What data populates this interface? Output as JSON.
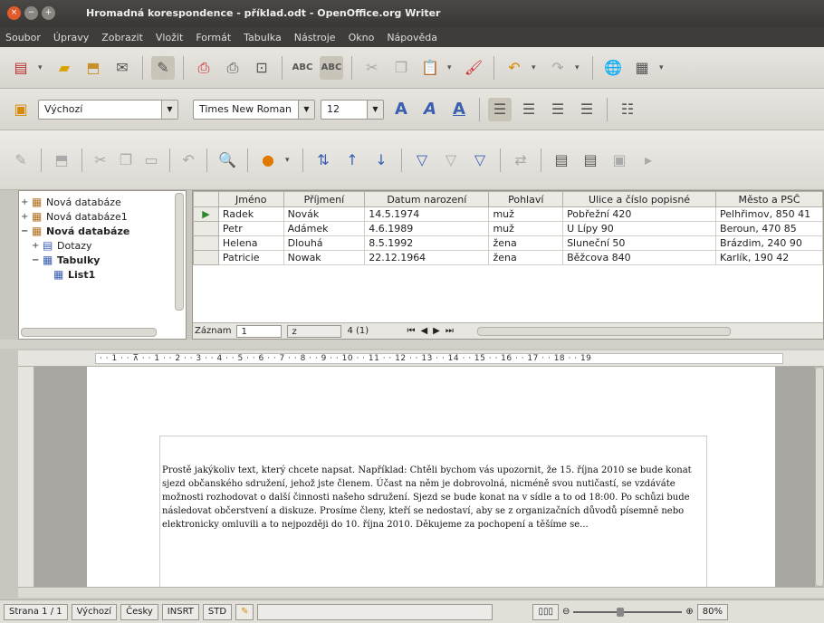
{
  "window": {
    "title": "Hromadná korespondence - příklad.odt - OpenOffice.org Writer"
  },
  "menu": [
    "Soubor",
    "Úpravy",
    "Zobrazit",
    "Vložit",
    "Formát",
    "Tabulka",
    "Nástroje",
    "Okno",
    "Nápověda"
  ],
  "toolbar": {
    "style_value": "Výchozí",
    "font_value": "Times New Roman",
    "size_value": "12"
  },
  "tree": {
    "items": [
      {
        "label": "Nová databáze",
        "expander": "+",
        "bold": false
      },
      {
        "label": "Nová databáze1",
        "expander": "+",
        "bold": false
      },
      {
        "label": "Nová databáze",
        "expander": "−",
        "bold": true
      },
      {
        "label": "Dotazy",
        "expander": "+",
        "bold": false
      },
      {
        "label": "Tabulky",
        "expander": "−",
        "bold": true
      },
      {
        "label": "List1",
        "expander": "",
        "bold": true
      }
    ]
  },
  "grid": {
    "columns": [
      "Jméno",
      "Příjmení",
      "Datum narození",
      "Pohlaví",
      "Ulice a číslo popisné",
      "Město a PSČ"
    ],
    "rows": [
      [
        "Radek",
        "Novák",
        "14.5.1974",
        "muž",
        "Pobřežní 420",
        "Pelhřimov, 850 41"
      ],
      [
        "Petr",
        "Adámek",
        "4.6.1989",
        "muž",
        "U Lípy 90",
        "Beroun, 470 85"
      ],
      [
        "Helena",
        "Dlouhá",
        "8.5.1992",
        "žena",
        "Sluneční 50",
        "Brázdim, 240 90"
      ],
      [
        "Patricie",
        "Nowak",
        "22.12.1964",
        "žena",
        "Běžcova 840",
        "Karlík, 190 42"
      ]
    ],
    "nav": {
      "record_label": "Záznam",
      "record_value": "1",
      "of_label": "z",
      "count": "4 (1)"
    }
  },
  "ruler": {
    "marks": "· · 1 · · ⊼ · · 1 · · 2 · · 3 · · 4 · · 5 · · 6 · · 7 · · 8 · · 9 · · 10 · · 11 · · 12 · · 13 · · 14 · · 15 · · 16 · · 17 · · 18 · · 19"
  },
  "document": {
    "text": "Prostě jakýkoliv text, který chcete napsat. Například: Chtěli bychom vás upozornit, že 15. října 2010 se bude konat sjezd občanského sdružení, jehož jste členem. Účast na něm je dobrovolná, nicméně svou nutičastí, se vzdáváte možnosti rozhodovat o další činnosti našeho sdružení. Sjezd se bude konat na v sídle a to od 18:00. Po schůzi bude následovat občerstvení a diskuze. Prosíme členy, kteří se nedostaví, aby se z organizačních důvodů písemně nebo elektronicky omluvili a to nejpozději do 10. října 2010. Děkujeme za pochopení a těšíme se..."
  },
  "status": {
    "page": "Strana 1 / 1",
    "style": "Výchozí",
    "language": "Česky",
    "insert": "INSRT",
    "selection": "STD",
    "zoom": "80%"
  }
}
